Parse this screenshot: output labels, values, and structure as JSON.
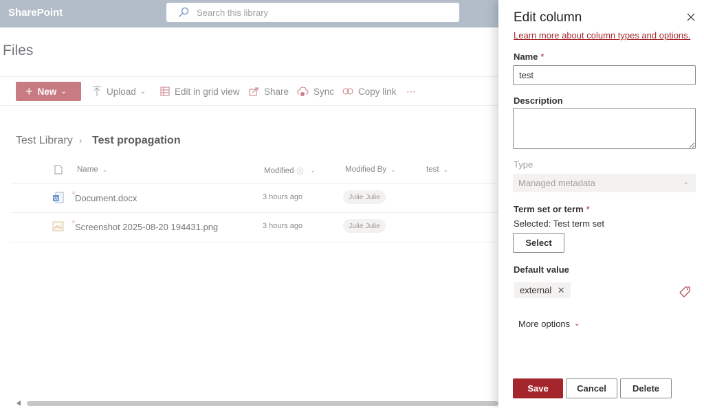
{
  "suite": {
    "brand": "SharePoint",
    "search_placeholder": "Search this library"
  },
  "page": {
    "title": "Files"
  },
  "commands": {
    "new": "New",
    "upload": "Upload",
    "edit_grid": "Edit in grid view",
    "share": "Share",
    "sync": "Sync",
    "copy_link": "Copy link",
    "more": "⋯"
  },
  "breadcrumb": {
    "root": "Test Library",
    "sep": "›",
    "current": "Test propagation"
  },
  "columns": {
    "name": "Name",
    "modified": "Modified",
    "modified_by": "Modified By",
    "test": "test"
  },
  "files": [
    {
      "name": "Document.docx",
      "modified": "3 hours ago",
      "modified_by": "Julie Julie",
      "icon": "word-file-icon"
    },
    {
      "name": "Screenshot 2025-08-20 194431.png",
      "modified": "3 hours ago",
      "modified_by": "Julie Julie",
      "icon": "image-file-icon"
    }
  ],
  "panel": {
    "title": "Edit column",
    "learn_link": "Learn more about column types and options.",
    "name_label": "Name",
    "required_mark": "*",
    "name_value": "test",
    "description_label": "Description",
    "description_value": "",
    "type_label": "Type",
    "type_value": "Managed metadata",
    "termset_label": "Term set or term",
    "selected_prefix": "Selected:",
    "selected_value": "Test term set",
    "select_button": "Select",
    "default_label": "Default value",
    "default_chip": "external",
    "more_options": "More options",
    "save": "Save",
    "cancel": "Cancel",
    "delete": "Delete"
  },
  "colors": {
    "accent": "#a4262c",
    "suitebar": "#b3bdc9"
  }
}
